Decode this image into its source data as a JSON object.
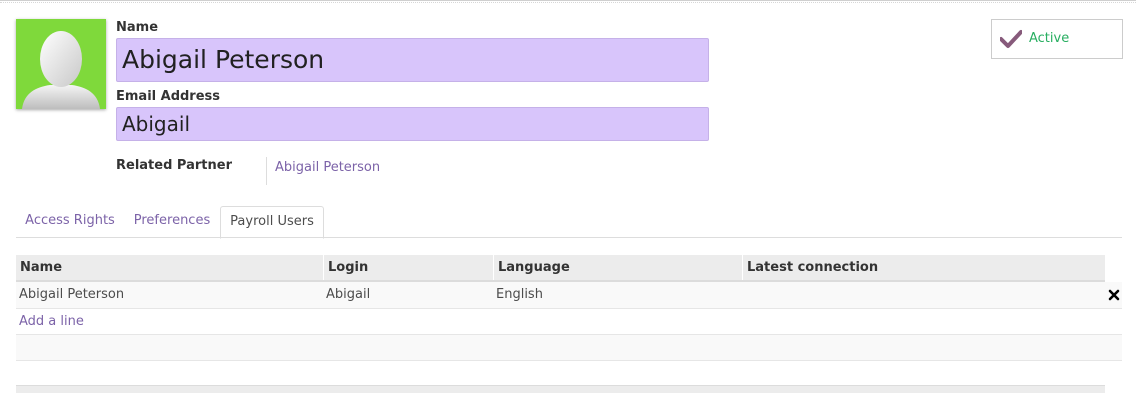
{
  "user": {
    "name_label": "Name",
    "name_value": "Abigail Peterson",
    "email_label": "Email Address",
    "email_value": "Abigail",
    "partner_label": "Related Partner",
    "partner_value": "Abigail Peterson",
    "avatar_color": "#7fd93b",
    "field_highlight_color": "#d8c5fb"
  },
  "status_button": {
    "label": "Active",
    "icon": "checkmark-icon",
    "icon_color": "#875a7b",
    "label_color": "#27ae60"
  },
  "tabs": [
    {
      "label": "Access Rights",
      "active": false
    },
    {
      "label": "Preferences",
      "active": false
    },
    {
      "label": "Payroll Users",
      "active": true
    }
  ],
  "table": {
    "columns": [
      "Name",
      "Login",
      "Language",
      "Latest connection"
    ],
    "rows": [
      {
        "name": "Abigail Peterson",
        "login": "Abigail",
        "language": "English",
        "latest_connection": ""
      }
    ],
    "add_line_label": "Add a line",
    "delete_icon": "close-icon"
  },
  "colors": {
    "link": "#7c63a8",
    "accent": "#875a7b"
  }
}
